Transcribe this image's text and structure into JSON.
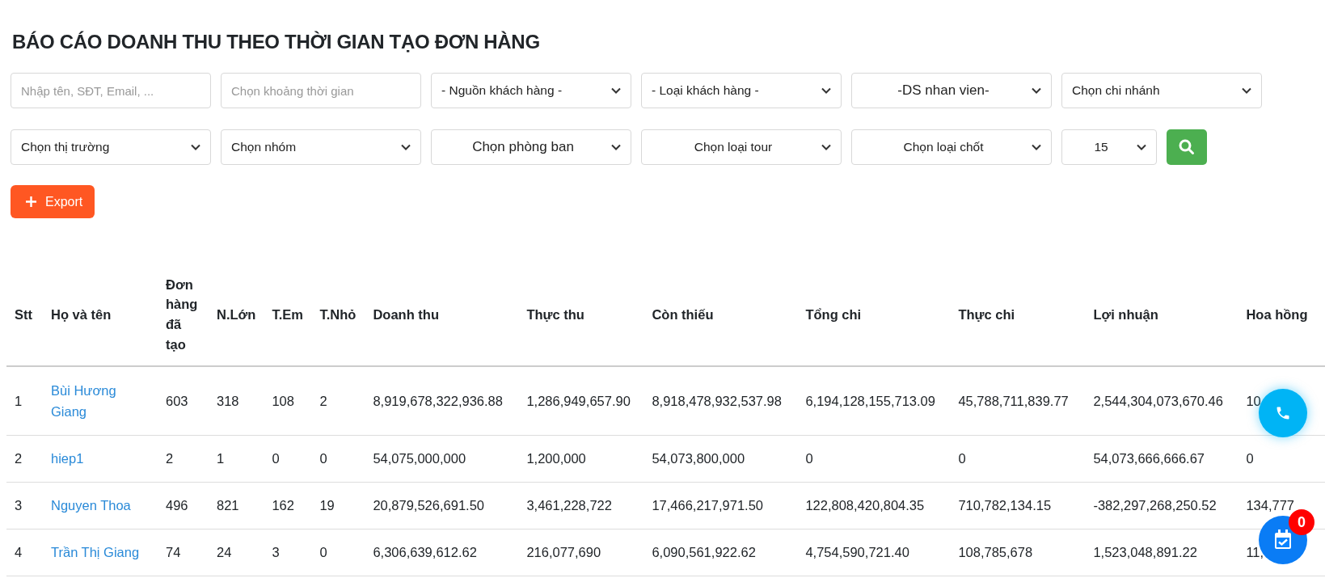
{
  "title": "BÁO CÁO DOANH THU THEO THỜI GIAN TẠO ĐƠN HÀNG",
  "filters": [
    {
      "kind": "input",
      "placeholder": "Nhập tên, SĐT, Email, ..."
    },
    {
      "kind": "input",
      "placeholder": "Chọn khoảng thời gian"
    },
    {
      "kind": "select",
      "value": "- Nguồn khách hàng -"
    },
    {
      "kind": "select",
      "value": "- Loại khách hàng -"
    },
    {
      "kind": "select-center",
      "value": "-DS nhan vien-"
    },
    {
      "kind": "select",
      "value": "Chọn chi nhánh"
    },
    {
      "kind": "select",
      "value": "Chọn thị trường"
    },
    {
      "kind": "select",
      "value": "Chọn nhóm"
    },
    {
      "kind": "select-center",
      "value": "Chọn phòng ban"
    },
    {
      "kind": "select-center",
      "value": "Chọn loại tour"
    },
    {
      "kind": "select-center",
      "value": "Chọn loại chốt"
    },
    {
      "kind": "select-small",
      "value": "15"
    },
    {
      "kind": "search-button"
    }
  ],
  "export_button": "Export",
  "table": {
    "columns": [
      "Stt",
      "Họ và tên",
      "Đơn hàng đã tạo",
      "N.Lớn",
      "T.Em",
      "T.Nhỏ",
      "Doanh thu",
      "Thực thu",
      "Còn thiếu",
      "Tổng chi",
      "Thực chi",
      "Lợi nhuận",
      "Hoa hồng"
    ],
    "rows": [
      [
        "1",
        "Bùi Hương Giang",
        "603",
        "318",
        "108",
        "2",
        "8,919,678,322,936.88",
        "1,286,949,657.90",
        "8,918,478,932,537.98",
        "6,194,128,155,713.09",
        "45,788,711,839.77",
        "2,544,304,073,670.46",
        "10"
      ],
      [
        "2",
        "hiep1",
        "2",
        "1",
        "0",
        "0",
        "54,075,000,000",
        "1,200,000",
        "54,073,800,000",
        "0",
        "0",
        "54,073,666,666.67",
        "0"
      ],
      [
        "3",
        "Nguyen Thoa",
        "496",
        "821",
        "162",
        "19",
        "20,879,526,691.50",
        "3,461,228,722",
        "17,466,217,971.50",
        "122,808,420,804.35",
        "710,782,134.15",
        "-382,297,268,250.52",
        "134,777"
      ],
      [
        "4",
        "Trần Thị Giang",
        "74",
        "24",
        "3",
        "0",
        "6,306,639,612.62",
        "216,077,690",
        "6,090,561,922.62",
        "4,754,590,721.40",
        "108,785,678",
        "1,523,048,891.22",
        "11,"
      ]
    ]
  },
  "task_badge": "0"
}
